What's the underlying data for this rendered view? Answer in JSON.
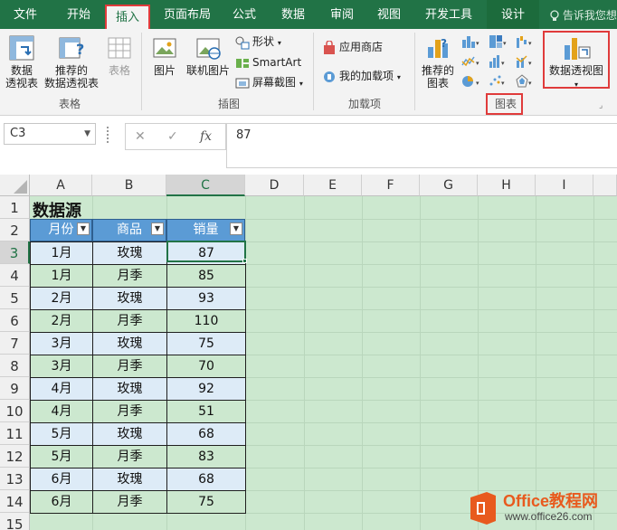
{
  "tabs": [
    "文件",
    "开始",
    "插入",
    "页面布局",
    "公式",
    "数据",
    "审阅",
    "视图",
    "开发工具",
    "设计"
  ],
  "tell_me": "告诉我您想",
  "ribbon": {
    "tables_group": "表格",
    "pivot_btn": [
      "数据",
      "透视表"
    ],
    "rec_pivot_btn": [
      "推荐的",
      "数据透视表"
    ],
    "table_btn": "表格",
    "illus_group": "插图",
    "pictures_btn": "图片",
    "online_pic_btn": "联机图片",
    "shapes_btn": "形状",
    "smartart_btn": "SmartArt",
    "screenshot_btn": "屏幕截图",
    "addins_group": "加载项",
    "store_btn": "应用商店",
    "myaddins_btn": "我的加载项",
    "rec_chart_btn": [
      "推荐的",
      "图表"
    ],
    "charts_group": "图表",
    "pivotchart_btn": "数据透视图"
  },
  "formula_bar": {
    "name_box": "C3",
    "fx": "fx",
    "value": "87"
  },
  "columns": [
    "A",
    "B",
    "C",
    "D",
    "E",
    "F",
    "G",
    "H",
    "I"
  ],
  "rows": [
    "1",
    "2",
    "3",
    "4",
    "5",
    "6",
    "7",
    "8",
    "9",
    "10",
    "11",
    "12",
    "13",
    "14",
    "15"
  ],
  "sheet_title": "数据源",
  "table": {
    "headers": [
      "月份",
      "商品",
      "销量"
    ],
    "rows": [
      [
        "1月",
        "玫瑰",
        "87"
      ],
      [
        "1月",
        "月季",
        "85"
      ],
      [
        "2月",
        "玫瑰",
        "93"
      ],
      [
        "2月",
        "月季",
        "110"
      ],
      [
        "3月",
        "玫瑰",
        "75"
      ],
      [
        "3月",
        "月季",
        "70"
      ],
      [
        "4月",
        "玫瑰",
        "92"
      ],
      [
        "4月",
        "月季",
        "51"
      ],
      [
        "5月",
        "玫瑰",
        "68"
      ],
      [
        "5月",
        "月季",
        "83"
      ],
      [
        "6月",
        "玫瑰",
        "68"
      ],
      [
        "6月",
        "月季",
        "75"
      ]
    ]
  },
  "watermark": {
    "brand": "Office教程网",
    "url": "www.office26.com"
  },
  "colors": {
    "excel_green": "#217346",
    "table_header": "#5b9bd5",
    "highlight": "#e03b3b",
    "sheet_bg": "#cce8cf"
  }
}
